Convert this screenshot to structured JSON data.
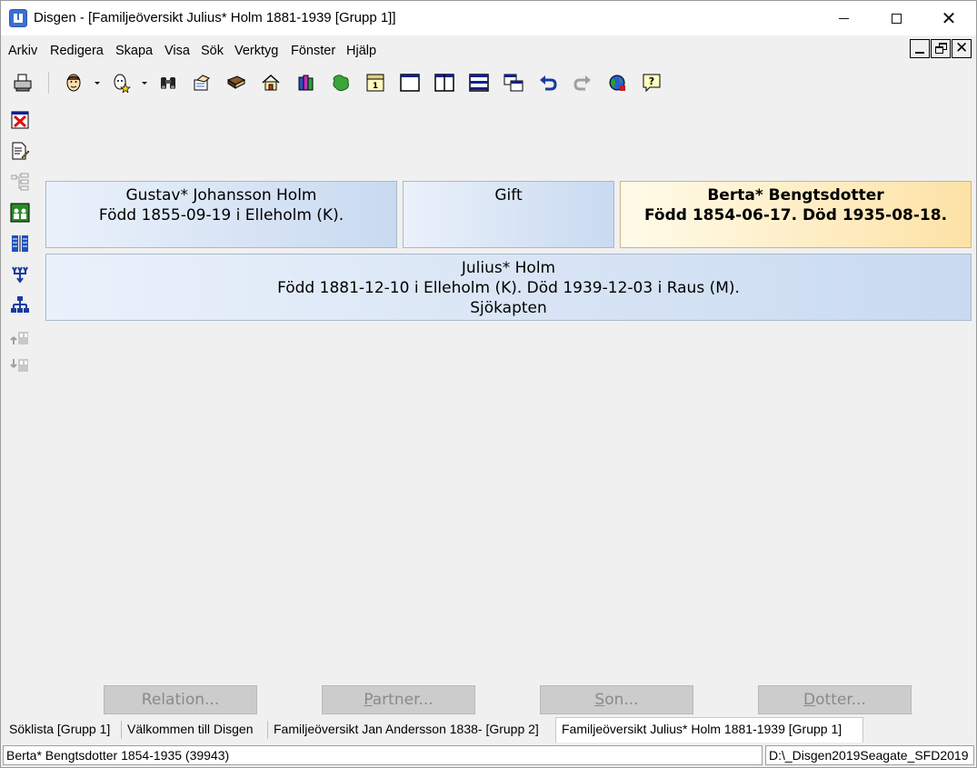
{
  "window": {
    "title": "Disgen - [Familjeöversikt Julius* Holm 1881-1939 [Grupp 1]]"
  },
  "menu": {
    "items": [
      "Arkiv",
      "Redigera",
      "Skapa",
      "Visa",
      "Sök",
      "Verktyg",
      "Fönster",
      "Hjälp"
    ]
  },
  "toolbar": {
    "icons": [
      "print-icon",
      "person-face-icon",
      "person-star-icon",
      "binoculars-icon",
      "hand-note-icon",
      "book-icon",
      "home-icon",
      "books-icon",
      "map-icon",
      "calendar-icon",
      "window-icon",
      "two-columns-icon",
      "three-rows-icon",
      "cascade-windows-icon",
      "undo-icon",
      "redo-icon",
      "globe-icon",
      "help-icon"
    ]
  },
  "left_toolbar": {
    "icons": [
      "delete-icon",
      "document-edit-icon",
      "tree-outline-icon",
      "family-group-icon",
      "columns-icon",
      "descendants-icon",
      "org-chart-icon",
      "ancestor-up-icon",
      "descendant-down-icon"
    ]
  },
  "family": {
    "father": {
      "name": "Gustav* Johansson Holm",
      "info": "Född 1855-09-19 i Elleholm (K)."
    },
    "relation": {
      "label": "Gift"
    },
    "mother": {
      "name": "Berta* Bengtsdotter",
      "info": "Född 1854-06-17. Död 1935-08-18."
    },
    "person": {
      "name": "Julius* Holm",
      "info": "Född 1881-12-10 i Elleholm (K). Död 1939-12-03 i Raus (M).",
      "occupation": "Sjökapten"
    }
  },
  "actions": {
    "relation": {
      "first": "R",
      "rest": "elation..."
    },
    "partner": {
      "first": "P",
      "rest": "artner..."
    },
    "son": {
      "first": "S",
      "rest": "on..."
    },
    "dotter": {
      "first": "D",
      "rest": "otter..."
    }
  },
  "tabs": [
    "Söklista [Grupp 1]",
    "Välkommen till Disgen",
    "Familjeöversikt Jan Andersson 1838- [Grupp 2]",
    "Familjeöversikt Julius* Holm 1881-1939 [Grupp 1]"
  ],
  "status": {
    "left": "Berta* Bengtsdotter 1854-1935 (39943)",
    "right": "D:\\_Disgen2019Seagate_SFD2019"
  }
}
